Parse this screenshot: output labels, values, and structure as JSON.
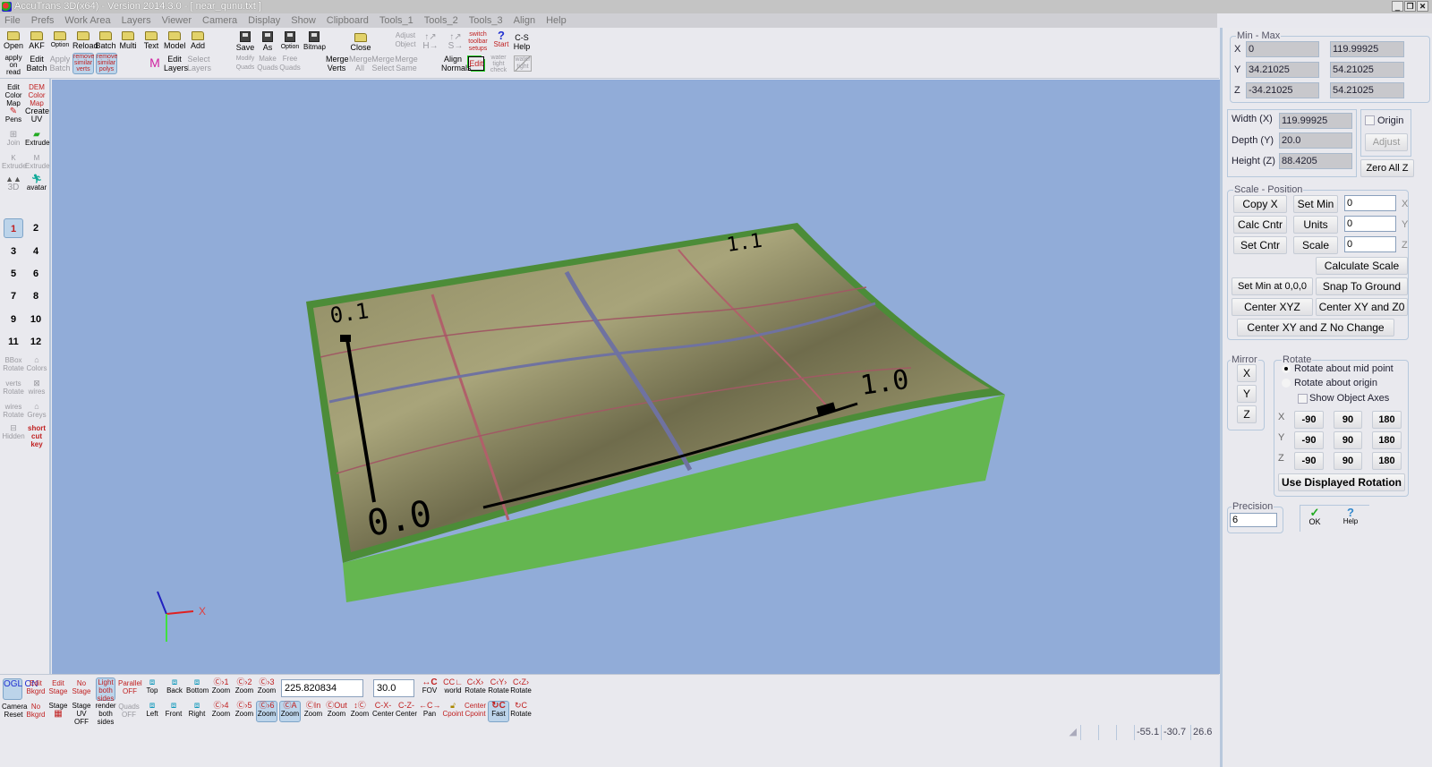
{
  "window": {
    "title": "AccuTrans 3D(x64) - Version 2014.3.0 - [ near_qunu.txt ]",
    "controls": {
      "minimize": "_",
      "restore": "❐",
      "close": "✕"
    }
  },
  "menu": [
    "File",
    "Prefs",
    "Work Area",
    "Layers",
    "Viewer",
    "Camera",
    "Display",
    "Show",
    "Clipboard",
    "Tools_1",
    "Tools_2",
    "Tools_3",
    "Align",
    "Help"
  ],
  "top_toolbar": {
    "row1": [
      {
        "id": "open",
        "label": "Open",
        "icon": "folder-icon"
      },
      {
        "id": "akf",
        "label": "AKF",
        "icon": "folder-icon"
      },
      {
        "id": "option",
        "label": "Option",
        "icon": "folder-icon"
      },
      {
        "id": "reload",
        "label": "Reload",
        "icon": "folder-icon"
      },
      {
        "id": "batch",
        "label": "Batch",
        "icon": "folder-icon"
      },
      {
        "id": "multi",
        "label": "Multi",
        "icon": "folder-icon"
      },
      {
        "id": "text",
        "label": "Text",
        "icon": "folder-icon"
      },
      {
        "id": "model",
        "label": "Model",
        "icon": "folder-icon"
      },
      {
        "id": "add",
        "label": "Add",
        "icon": "folder-icon"
      },
      {
        "id": "save",
        "label": "Save",
        "icon": "floppy-icon"
      },
      {
        "id": "save-as",
        "label": "As",
        "icon": "floppy-icon"
      },
      {
        "id": "save-option",
        "label": "Option",
        "icon": "floppy-icon"
      },
      {
        "id": "bitmap",
        "label": "Bitmap",
        "icon": "floppy-icon"
      },
      {
        "id": "close",
        "label": "Close",
        "icon": "folder-icon"
      },
      {
        "id": "adjust-object",
        "label": "Adjust Object",
        "icon": "arrows-icon"
      },
      {
        "id": "h-arrows",
        "label": "H",
        "icon": "h-axis-icon"
      },
      {
        "id": "s-arrows",
        "label": "S",
        "icon": "s-axis-icon"
      },
      {
        "id": "switch-toolbar",
        "label": "switch toolbar setups",
        "icon": "switch-icon"
      },
      {
        "id": "start",
        "label": "Start",
        "icon": "question-cursor-icon"
      },
      {
        "id": "cs-help",
        "label": "C-S Help",
        "icon": "help-icon"
      }
    ],
    "row2": [
      {
        "id": "apply-on-read",
        "label": "apply on read"
      },
      {
        "id": "edit-batch",
        "label": "Edit Batch"
      },
      {
        "id": "apply-batch",
        "label": "Apply Batch"
      },
      {
        "id": "remove-similar-verts",
        "label": "remove similar verts"
      },
      {
        "id": "remove-similar-polys",
        "label": "remove similar polys"
      },
      {
        "id": "material",
        "label": "M"
      },
      {
        "id": "edit-layers",
        "label": "Edit Layers"
      },
      {
        "id": "select-layers",
        "label": "Select Layers"
      },
      {
        "id": "modify-quads",
        "label": "Modify Quads"
      },
      {
        "id": "make-quads",
        "label": "Make Quads"
      },
      {
        "id": "free-quads",
        "label": "Free Quads"
      },
      {
        "id": "merge-verts",
        "label": "Merge Verts"
      },
      {
        "id": "merge-all",
        "label": "Merge All"
      },
      {
        "id": "merge-select",
        "label": "Merge Select"
      },
      {
        "id": "merge-same",
        "label": "Merge Same"
      },
      {
        "id": "align-normals",
        "label": "Align Normals"
      },
      {
        "id": "edit",
        "label": "Edit"
      },
      {
        "id": "water-tight-check",
        "label": "water tight check"
      },
      {
        "id": "water-tight",
        "label": "water tight"
      }
    ]
  },
  "left_toolbar": {
    "tools": [
      {
        "id": "edit-color-map",
        "label": "Edit Color Map"
      },
      {
        "id": "dem-color-map",
        "label": "DEM Color Map"
      },
      {
        "id": "pens",
        "label": "Pens"
      },
      {
        "id": "create-uv",
        "label": "Create UV"
      },
      {
        "id": "join",
        "label": "Join"
      },
      {
        "id": "extrude",
        "label": "Extrude"
      },
      {
        "id": "extrude-k",
        "label": "K Extrude"
      },
      {
        "id": "extrude-m",
        "label": "M Extrude"
      },
      {
        "id": "to-3d",
        "label": "3D"
      },
      {
        "id": "avatar",
        "label": "avatar"
      }
    ],
    "layers": [
      "1",
      "2",
      "3",
      "4",
      "5",
      "6",
      "7",
      "8",
      "9",
      "10",
      "11",
      "12"
    ],
    "active_layer": "1",
    "bottom_tools": [
      {
        "id": "bbox-rotate",
        "label": "BBox Rotate"
      },
      {
        "id": "colors",
        "label": "Colors"
      },
      {
        "id": "verts-rotate",
        "label": "verts Rotate"
      },
      {
        "id": "wires",
        "label": "wires"
      },
      {
        "id": "wires-rotate",
        "label": "wires Rotate"
      },
      {
        "id": "greys",
        "label": "Greys"
      },
      {
        "id": "hidden",
        "label": "Hidden"
      },
      {
        "id": "shortcut-key",
        "label": "short cut key"
      }
    ]
  },
  "viewport": {
    "background": "#91acd8",
    "model_labels": {
      "origin": "0.0",
      "top_left": "0.1",
      "bottom_right": "1.0",
      "top_right": "1.1"
    },
    "axis_x_label": "X"
  },
  "bottom_toolbar": {
    "row1": [
      {
        "id": "ogl-on",
        "label": "OGL ON"
      },
      {
        "id": "edit-bkgrd",
        "label": "Edit Bkgrd"
      },
      {
        "id": "edit-stage",
        "label": "Edit Stage"
      },
      {
        "id": "no-stage",
        "label": "No Stage"
      },
      {
        "id": "light-both-sides",
        "label": "Light both sides"
      },
      {
        "id": "parallel-off",
        "label": "Parallel OFF"
      },
      {
        "id": "view-top",
        "label": "Top"
      },
      {
        "id": "view-back",
        "label": "Back"
      },
      {
        "id": "view-bottom",
        "label": "Bottom"
      },
      {
        "id": "zoom-1",
        "label": "Zoom"
      },
      {
        "id": "zoom-2",
        "label": "Zoom"
      },
      {
        "id": "zoom-3",
        "label": "Zoom"
      }
    ],
    "row2": [
      {
        "id": "camera-reset",
        "label": "Camera Reset"
      },
      {
        "id": "no-bkgrd",
        "label": "No Bkgrd"
      },
      {
        "id": "stage-grid",
        "label": "Stage"
      },
      {
        "id": "stage-uv-off",
        "label": "Stage UV OFF"
      },
      {
        "id": "render-both-sides",
        "label": "render both sides"
      },
      {
        "id": "quads-off",
        "label": "Quads OFF"
      },
      {
        "id": "view-left",
        "label": "Left"
      },
      {
        "id": "view-front",
        "label": "Front"
      },
      {
        "id": "view-right",
        "label": "Right"
      },
      {
        "id": "zoom-4",
        "label": "Zoom"
      },
      {
        "id": "zoom-5",
        "label": "Zoom"
      },
      {
        "id": "zoom-6",
        "label": "Zoom"
      }
    ],
    "camera_distance": "225.820834",
    "fov_value": "30.0",
    "right_row1": [
      {
        "id": "fov",
        "label": "FOV"
      },
      {
        "id": "world",
        "label": "world"
      },
      {
        "id": "rotate-x",
        "label": "Rotate"
      },
      {
        "id": "rotate-y",
        "label": "Rotate"
      },
      {
        "id": "rotate-z",
        "label": "Rotate"
      }
    ],
    "right_row2": [
      {
        "id": "zoom-a",
        "label": "Zoom"
      },
      {
        "id": "zoom-in",
        "label": "Zoom"
      },
      {
        "id": "zoom-out",
        "label": "Zoom"
      },
      {
        "id": "zoom-scroll",
        "label": "Zoom"
      },
      {
        "id": "center-x",
        "label": "Center"
      },
      {
        "id": "center-z",
        "label": "Center"
      },
      {
        "id": "pan",
        "label": "Pan"
      },
      {
        "id": "cpoint-lock",
        "label": "Cpoint"
      },
      {
        "id": "center-cpoint",
        "label": "Center Cpoint"
      },
      {
        "id": "fast",
        "label": "Fast"
      },
      {
        "id": "rotate-c",
        "label": "Rotate"
      }
    ]
  },
  "status_bar": {
    "coord_x": "-55.1",
    "coord_y": "-30.7",
    "coord_z": "26.6"
  },
  "right_panel": {
    "min_max": {
      "title": "Min - Max",
      "rows": [
        {
          "axis": "X",
          "min": "0",
          "max": "119.99925"
        },
        {
          "axis": "Y",
          "min": "34.21025",
          "max": "54.21025"
        },
        {
          "axis": "Z",
          "min": "-34.21025",
          "max": "54.21025"
        }
      ]
    },
    "dimensions": {
      "width_label": "Width (X)",
      "width": "119.99925",
      "depth_label": "Depth (Y)",
      "depth": "20.0",
      "height_label": "Height (Z)",
      "height": "88.4205"
    },
    "origin": {
      "label": "Origin",
      "checked": false,
      "adjust_label": "Adjust"
    },
    "zero_all_z": "Zero All Z",
    "scale_position": {
      "title": "Scale - Position",
      "copy_x": "Copy X",
      "set_min": "Set Min",
      "calc_cntr": "Calc Cntr",
      "units": "Units",
      "set_cntr": "Set Cntr",
      "scale": "Scale",
      "x_value": "0",
      "y_value": "0",
      "z_value": "0",
      "x_label": "X",
      "y_label": "Y",
      "z_label": "Z",
      "calculate_scale": "Calculate Scale",
      "set_min_000": "Set Min at 0,0,0",
      "snap_to_ground": "Snap To Ground",
      "center_xyz": "Center XYZ",
      "center_xy_z0": "Center XY and Z0",
      "center_xy_z_no_change": "Center XY and Z No Change"
    },
    "mirror": {
      "title": "Mirror",
      "x": "X",
      "y": "Y",
      "z": "Z"
    },
    "rotate": {
      "title": "Rotate",
      "about_mid": "Rotate about mid point",
      "about_origin": "Rotate about origin",
      "selected": "mid",
      "show_axes": "Show Object Axes",
      "show_axes_checked": false,
      "rows": [
        {
          "axis": "X",
          "values": [
            "-90",
            "90",
            "180"
          ]
        },
        {
          "axis": "Y",
          "values": [
            "-90",
            "90",
            "180"
          ]
        },
        {
          "axis": "Z",
          "values": [
            "-90",
            "90",
            "180"
          ]
        }
      ],
      "use_displayed": "Use Displayed Rotation"
    },
    "precision": {
      "title": "Precision",
      "value": "6"
    },
    "ok_label": "OK",
    "help_label": "Help"
  }
}
